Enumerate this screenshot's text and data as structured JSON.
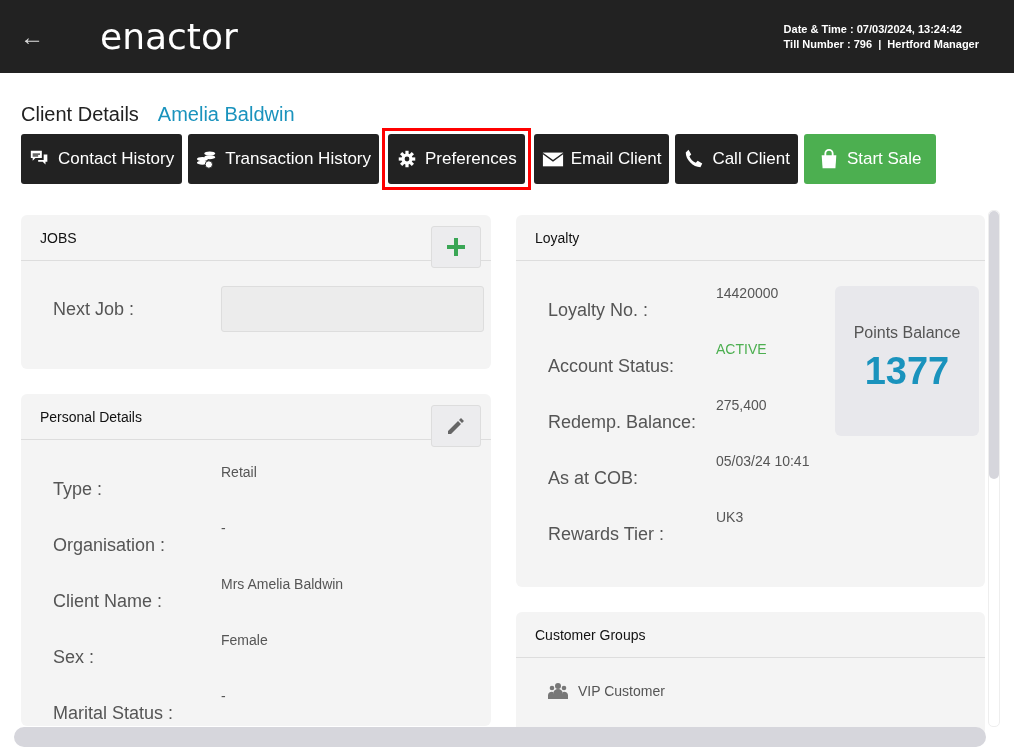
{
  "header": {
    "back": "←",
    "logo": "enactor",
    "date_time": "Date & Time : 07/03/2024, 13:24:42",
    "till": "Till Number : 796  |  Hertford Manager"
  },
  "page": {
    "title": "Client Details",
    "client_name": "Amelia Baldwin"
  },
  "actions": [
    {
      "label": "Contact History",
      "kind": "dark",
      "highlighted": false
    },
    {
      "label": "Transaction History",
      "kind": "dark",
      "highlighted": false
    },
    {
      "label": "Preferences",
      "kind": "dark",
      "highlighted": true
    },
    {
      "label": "Email Client",
      "kind": "dark",
      "highlighted": false
    },
    {
      "label": "Call Client",
      "kind": "dark",
      "highlighted": false
    },
    {
      "label": "Start Sale",
      "kind": "success",
      "highlighted": false
    }
  ],
  "jobs": {
    "title": "JOBS",
    "next_job_label": "Next Job :"
  },
  "personal_details": {
    "title": "Personal Details",
    "rows": [
      {
        "label": "Type :",
        "value": "Retail"
      },
      {
        "label": "Organisation :",
        "value": "-"
      },
      {
        "label": "Client Name :",
        "value": "Mrs Amelia Baldwin"
      },
      {
        "label": "Sex :",
        "value": "Female"
      },
      {
        "label": "Marital Status :",
        "value": "-"
      }
    ]
  },
  "loyalty": {
    "title": "Loyalty",
    "rows": [
      {
        "label": "Loyalty No. :",
        "value": "14420000",
        "kind": "plain"
      },
      {
        "label": "Account Status:",
        "value": "ACTIVE",
        "kind": "status"
      },
      {
        "label": "Redemp. Balance:",
        "value": "275,400",
        "kind": "plain"
      },
      {
        "label": "As at COB:",
        "value": "05/03/24 10:41",
        "kind": "plain"
      },
      {
        "label": "Rewards Tier :",
        "value": "UK3",
        "kind": "plain"
      }
    ],
    "points_label": "Points Balance",
    "points_value": "1377"
  },
  "customer_groups": {
    "title": "Customer Groups",
    "items": [
      "VIP Customer"
    ]
  }
}
